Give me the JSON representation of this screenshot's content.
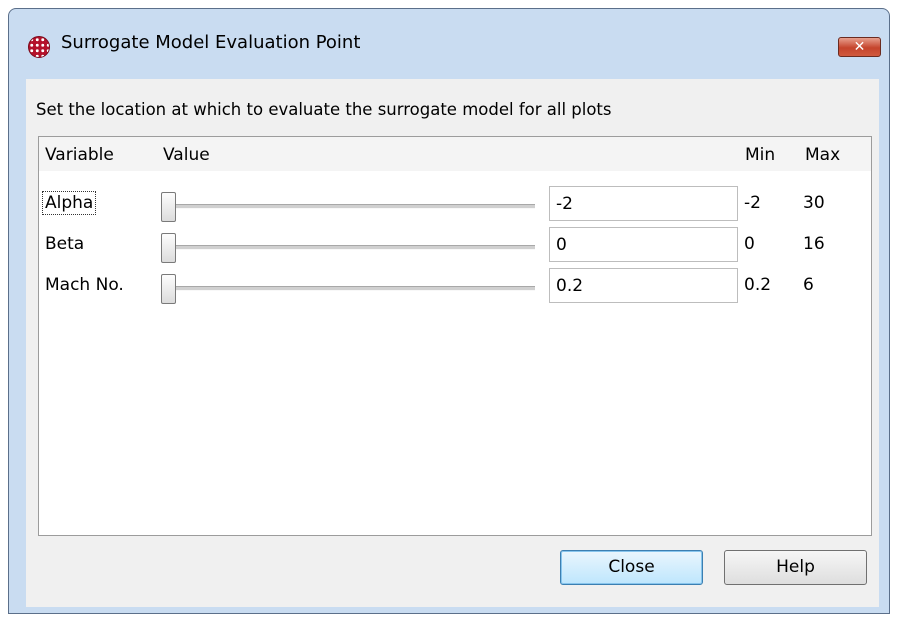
{
  "window": {
    "title": "Surrogate Model Evaluation Point",
    "close_glyph": "✕",
    "app_icon": "grid-globe-icon"
  },
  "instruction": "Set the location at which to evaluate the surrogate model for all plots",
  "table": {
    "headers": {
      "variable": "Variable",
      "value": "Value",
      "min": "Min",
      "max": "Max"
    },
    "rows": [
      {
        "variable": "Alpha",
        "value": "-2",
        "min": "-2",
        "max": "30",
        "slider_fraction": 0.0,
        "focused": true
      },
      {
        "variable": "Beta",
        "value": "0",
        "min": "0",
        "max": "16",
        "slider_fraction": 0.0,
        "focused": false
      },
      {
        "variable": "Mach No.",
        "value": "0.2",
        "min": "0.2",
        "max": "6",
        "slider_fraction": 0.0,
        "focused": false
      }
    ]
  },
  "buttons": {
    "close": "Close",
    "help": "Help"
  }
}
